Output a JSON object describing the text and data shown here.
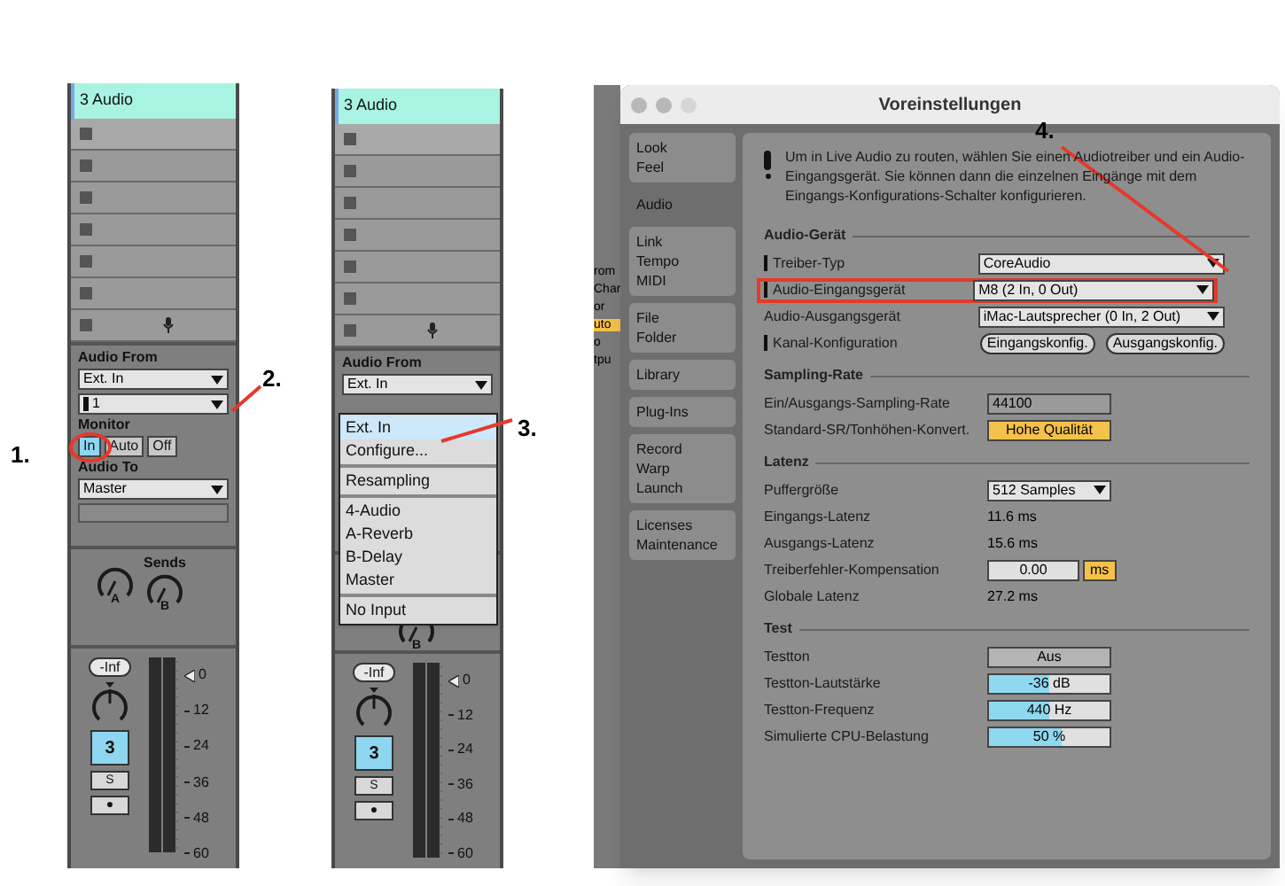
{
  "strips": [
    {
      "track_name": "3 Audio",
      "clip_slots": [
        {
          "kind": "slot"
        },
        {
          "kind": "slot"
        },
        {
          "kind": "slot"
        },
        {
          "kind": "slot"
        },
        {
          "kind": "slot"
        },
        {
          "kind": "slot"
        },
        {
          "kind": "input"
        }
      ],
      "audio_from": {
        "label": "Audio From",
        "source": "Ext. In",
        "channel": "1"
      },
      "monitor": {
        "label": "Monitor",
        "options": [
          {
            "label": "In",
            "selected": true
          },
          {
            "label": "Auto",
            "selected": false
          },
          {
            "label": "Off",
            "selected": false
          }
        ]
      },
      "audio_to": {
        "label": "Audio To",
        "value": "Master"
      },
      "sends": {
        "label": "Sends",
        "knobs": [
          "A",
          "B"
        ]
      },
      "volume": "-Inf",
      "track_number": "3",
      "solo": "S",
      "arm": "●",
      "meter_scale": [
        "0",
        "12",
        "24",
        "36",
        "48",
        "60"
      ]
    },
    {
      "track_name": "3 Audio",
      "clip_slots": [
        {
          "kind": "slot"
        },
        {
          "kind": "slot"
        },
        {
          "kind": "slot"
        },
        {
          "kind": "slot"
        },
        {
          "kind": "slot"
        },
        {
          "kind": "slot"
        },
        {
          "kind": "input"
        }
      ],
      "audio_from": {
        "label": "Audio From",
        "source": "Ext. In"
      },
      "menu": [
        {
          "items": [
            {
              "label": "Ext. In",
              "selected": true
            },
            {
              "label": "Configure...",
              "selected": false
            }
          ]
        },
        {
          "items": [
            {
              "label": "Resampling",
              "selected": false
            }
          ]
        },
        {
          "items": [
            {
              "label": "4-Audio",
              "selected": false
            },
            {
              "label": "A-Reverb",
              "selected": false
            },
            {
              "label": "B-Delay",
              "selected": false
            },
            {
              "label": "Master",
              "selected": false
            }
          ]
        },
        {
          "items": [
            {
              "label": "No Input",
              "selected": false
            }
          ]
        }
      ],
      "sends": {
        "knobs": [
          "B"
        ]
      },
      "volume": "-Inf",
      "track_number": "3",
      "solo": "S",
      "arm": "●",
      "meter_scale": [
        "0",
        "12",
        "24",
        "36",
        "48",
        "60"
      ]
    }
  ],
  "background_fragments": [
    "rom",
    "Char",
    "or",
    "uto",
    "o",
    "tpu"
  ],
  "prefs": {
    "title": "Voreinstellungen",
    "tabs": [
      {
        "lines": [
          "Look",
          "Feel"
        ],
        "selected": false
      },
      {
        "lines": [
          "Audio"
        ],
        "selected": true
      },
      {
        "lines": [
          "Link",
          "Tempo",
          "MIDI"
        ],
        "selected": false
      },
      {
        "lines": [
          "File",
          "Folder"
        ],
        "selected": false
      },
      {
        "lines": [
          "Library"
        ],
        "selected": false
      },
      {
        "lines": [
          "Plug-Ins"
        ],
        "selected": false
      },
      {
        "lines": [
          "Record",
          "Warp",
          "Launch"
        ],
        "selected": false
      },
      {
        "lines": [
          "Licenses",
          "Maintenance"
        ],
        "selected": false
      }
    ],
    "info": "Um in Live Audio zu routen, wählen Sie einen Audiotreiber und ein Audio-Eingangsgerät. Sie können dann die einzelnen Eingänge mit dem Eingangs-Konfigurations-Schalter konfigurieren.",
    "sections": [
      {
        "title": "Audio-Gerät",
        "rows": [
          {
            "kind": "select",
            "label": "Treiber-Typ",
            "warning": true,
            "value": "CoreAudio",
            "highlighted": false
          },
          {
            "kind": "select",
            "label": "Audio-Eingangsgerät",
            "warning": true,
            "value": "M8 (2 In, 0 Out)",
            "highlighted": true
          },
          {
            "kind": "select",
            "label": "Audio-Ausgangsgerät",
            "warning": false,
            "value": "iMac-Lautsprecher (0 In, 2 Out)",
            "highlighted": false
          },
          {
            "kind": "buttons",
            "label": "Kanal-Konfiguration",
            "warning": true,
            "buttons": [
              "Eingangskonfig.",
              "Ausgangskonfig."
            ]
          }
        ]
      },
      {
        "title": "Sampling-Rate",
        "rows": [
          {
            "kind": "field",
            "label": "Ein/Ausgangs-Sampling-Rate",
            "value": "44100"
          },
          {
            "kind": "toggle",
            "label": "Standard-SR/Tonhöhen-Konvert.",
            "value": "Hohe Qualität",
            "on": true
          }
        ]
      },
      {
        "title": "Latenz",
        "rows": [
          {
            "kind": "small_select",
            "label": "Puffergröße",
            "value": "512 Samples"
          },
          {
            "kind": "text",
            "label": "Eingangs-Latenz",
            "value": "11.6 ms"
          },
          {
            "kind": "text",
            "label": "Ausgangs-Latenz",
            "value": "15.6 ms"
          },
          {
            "kind": "unit_field",
            "label": "Treiberfehler-Kompensation",
            "value": "0.00",
            "unit": "ms"
          },
          {
            "kind": "text",
            "label": "Globale Latenz",
            "value": "27.2 ms"
          }
        ]
      },
      {
        "title": "Test",
        "rows": [
          {
            "kind": "toggle",
            "label": "Testton",
            "value": "Aus",
            "on": false
          },
          {
            "kind": "slider",
            "label": "Testton-Lautstärke",
            "value": "-36 dB",
            "level": 0.5
          },
          {
            "kind": "slider",
            "label": "Testton-Frequenz",
            "value": "440 Hz",
            "level": 0.5
          },
          {
            "kind": "slider",
            "label": "Simulierte CPU-Belastung",
            "value": "50 %",
            "level": 0.6
          }
        ]
      }
    ]
  },
  "annotations": [
    "1.",
    "2.",
    "3.",
    "4."
  ]
}
